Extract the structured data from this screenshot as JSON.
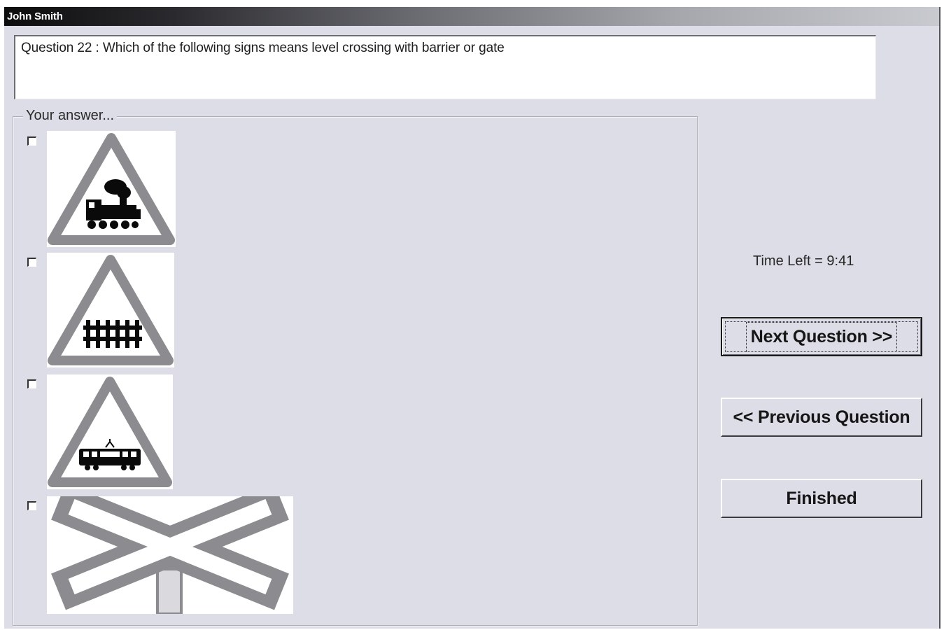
{
  "window": {
    "title": "John Smith"
  },
  "question": {
    "text": "Question 22 : Which of the following signs means level crossing with barrier or gate"
  },
  "answers": {
    "legend": "Your answer...",
    "options": [
      {
        "icon": "level-crossing-without-barrier-steam-train-sign",
        "checked": false
      },
      {
        "icon": "level-crossing-with-barrier-gate-sign",
        "checked": false
      },
      {
        "icon": "tramway-crossing-sign",
        "checked": false
      },
      {
        "icon": "saint-andrews-cross-level-crossing-sign",
        "checked": false
      }
    ]
  },
  "timer": {
    "text": "Time Left = 9:41"
  },
  "buttons": {
    "next": "Next Question >>",
    "previous": "<< Previous Question",
    "finished": "Finished"
  },
  "colors": {
    "sign_border": "#8c8c90",
    "sign_symbol": "#0a0a0a",
    "background": "#dcdde6"
  }
}
